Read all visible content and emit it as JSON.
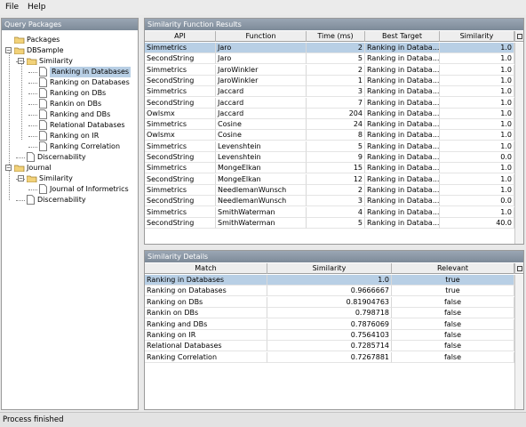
{
  "menu": {
    "file": "File",
    "help": "Help"
  },
  "query_panel": {
    "title": "Query Packages",
    "tree": {
      "root": "Packages",
      "dbsample": "DBSample",
      "similarity1": "Similarity",
      "leaf1": [
        "Ranking in Databases",
        "Ranking on Databases",
        "Ranking on DBs",
        "Rankin on DBs",
        "Ranking and DBs",
        "Relational Databases",
        "Ranking on IR",
        "Ranking Correlation"
      ],
      "discernability1": "Discernability",
      "journal": "Journal",
      "similarity2": "Similarity",
      "leaf2": [
        "Journal of Informetrics"
      ],
      "discernability2": "Discernability"
    }
  },
  "results_panel": {
    "title": "Similarity Function Results",
    "columns": [
      "API",
      "Function",
      "Time (ms)",
      "Best Target",
      "Similarity"
    ],
    "rows": [
      [
        "Simmetrics",
        "Jaro",
        "2",
        "Ranking in Databa...",
        "1.0"
      ],
      [
        "SecondString",
        "Jaro",
        "5",
        "Ranking in Databa...",
        "1.0"
      ],
      [
        "Simmetrics",
        "JaroWinkler",
        "2",
        "Ranking in Databa...",
        "1.0"
      ],
      [
        "SecondString",
        "JaroWinkler",
        "1",
        "Ranking in Databa...",
        "1.0"
      ],
      [
        "Simmetrics",
        "Jaccard",
        "3",
        "Ranking in Databa...",
        "1.0"
      ],
      [
        "SecondString",
        "Jaccard",
        "7",
        "Ranking in Databa...",
        "1.0"
      ],
      [
        "Owlsmx",
        "Jaccard",
        "204",
        "Ranking in Databa...",
        "1.0"
      ],
      [
        "Simmetrics",
        "Cosine",
        "24",
        "Ranking in Databa...",
        "1.0"
      ],
      [
        "Owlsmx",
        "Cosine",
        "8",
        "Ranking in Databa...",
        "1.0"
      ],
      [
        "Simmetrics",
        "Levenshtein",
        "5",
        "Ranking in Databa...",
        "1.0"
      ],
      [
        "SecondString",
        "Levenshtein",
        "9",
        "Ranking in Databa...",
        "0.0"
      ],
      [
        "Simmetrics",
        "MongeElkan",
        "15",
        "Ranking in Databa...",
        "1.0"
      ],
      [
        "SecondString",
        "MongeElkan",
        "12",
        "Ranking in Databa...",
        "1.0"
      ],
      [
        "Simmetrics",
        "NeedlemanWunsch",
        "2",
        "Ranking in Databa...",
        "1.0"
      ],
      [
        "SecondString",
        "NeedlemanWunsch",
        "3",
        "Ranking in Databa...",
        "0.0"
      ],
      [
        "Simmetrics",
        "SmithWaterman",
        "4",
        "Ranking in Databa...",
        "1.0"
      ],
      [
        "SecondString",
        "SmithWaterman",
        "5",
        "Ranking in Databa...",
        "40.0"
      ]
    ]
  },
  "details_panel": {
    "title": "Similarity Details",
    "columns": [
      "Match",
      "Similarity",
      "Relevant"
    ],
    "rows": [
      [
        "Ranking in Databases",
        "1.0",
        "true"
      ],
      [
        "Ranking on Databases",
        "0.9666667",
        "true"
      ],
      [
        "Ranking on DBs",
        "0.81904763",
        "false"
      ],
      [
        "Rankin on DBs",
        "0.798718",
        "false"
      ],
      [
        "Ranking and DBs",
        "0.7876069",
        "false"
      ],
      [
        "Ranking on IR",
        "0.7564103",
        "false"
      ],
      [
        "Relational Databases",
        "0.7285714",
        "false"
      ],
      [
        "Ranking Correlation",
        "0.7267881",
        "false"
      ]
    ]
  },
  "status": "Process finished",
  "colors": {
    "selection": "#b8cfe5",
    "title_bar": "#8794a3",
    "folder": "#f2d27a"
  }
}
